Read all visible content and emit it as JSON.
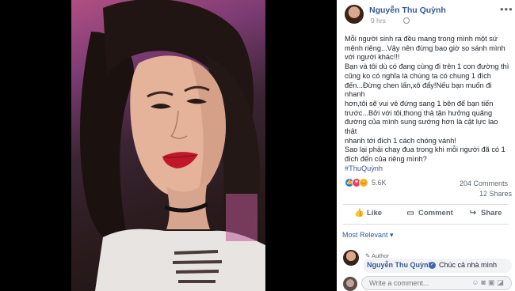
{
  "post": {
    "author": "Nguyễn Thu Quỳnh",
    "time": "9 hrs",
    "caption_lines": [
      "Mỗi người sinh ra đều mang trong mình một sứ",
      "mệnh riêng...Vậy nên đừng bao giờ so sánh mình",
      "với người khác!!!",
      "Bạn và tôi dù có đang cùng đi trên 1 con đường thì",
      "cũng ko có nghĩa là chúng ta có chung 1 đích",
      "đến...Đừng chen lấn,xô đẩy!Nếu bạn muốn đi nhanh",
      "hơn,tôi sẽ vui vẻ đứng sang 1 bên để bạn tiến",
      "trước...Bởi với tôi,thong thả tận hưởng quãng",
      "đường của mình sung sướng hơn là cật lực lao thật",
      "nhanh tới đích 1 cách chóng vánh!",
      "Sao lại phải chạy đua trong khi mỗi người đã có 1",
      "đích đến của riêng mình?"
    ],
    "hashtag": "#ThuQuỳnh"
  },
  "stats": {
    "reactions": "5.6K",
    "comments": "204 Comments",
    "shares": "12 Shares"
  },
  "actions": {
    "like": "Like",
    "comment": "Comment",
    "share": "Share"
  },
  "sort_label": "Most Relevant",
  "top_comment": {
    "badge": "Author",
    "name": "Nguyễn Thu Quỳnh",
    "text": "Chúc cả nhà mình"
  },
  "write_comment": {
    "placeholder": "Write a comment..."
  },
  "colors": {
    "link": "#365899",
    "like_blue": "#1877f2",
    "love_red": "#f33e58",
    "haha_yellow": "#f7b125"
  }
}
